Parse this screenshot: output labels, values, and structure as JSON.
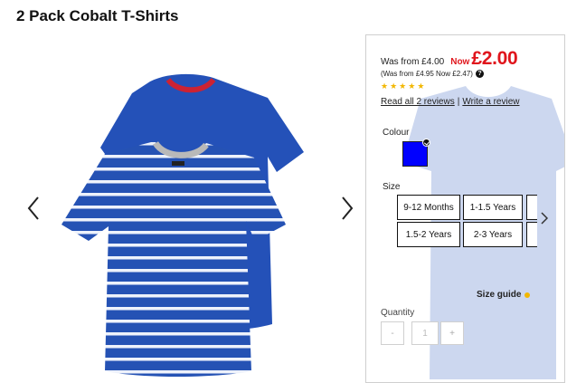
{
  "product": {
    "title": "2 Pack Cobalt T-Shirts"
  },
  "pricing": {
    "was_text": "Was from £4.00",
    "now_label": "Now",
    "now_price": "£2.00",
    "sub_text": "(Was from £4.95 Now £2.47)",
    "help_icon": "?"
  },
  "rating": {
    "stars": 5,
    "star_glyph": "★",
    "color": "#f2b701"
  },
  "reviews": {
    "read_label": "Read all 2 reviews",
    "separator": "|",
    "write_label": "Write a review"
  },
  "colour": {
    "label": "Colour",
    "selected_hex": "#0000ff"
  },
  "size": {
    "label": "Size",
    "options": [
      "9-12 Months",
      "1-1.5 Years",
      "1.5-2 Years",
      "2-3 Years"
    ]
  },
  "size_guide": {
    "label": "Size guide"
  },
  "quantity": {
    "label": "Quantity",
    "minus": "-",
    "value": "1",
    "plus": "+"
  },
  "colors": {
    "price_red": "#e0151c",
    "shirt_blue": "#1f4fb0",
    "swatch": "#0000ff"
  },
  "icons": {
    "prev": "chevron-left-icon",
    "next": "chevron-right-icon",
    "size_next": "chevron-right-icon",
    "help": "question-circle-icon",
    "selected": "check-icon"
  }
}
